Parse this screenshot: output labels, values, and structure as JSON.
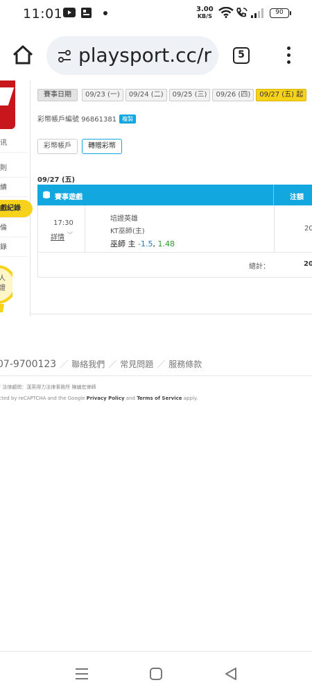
{
  "status_bar": {
    "time": "11:01",
    "speed_value": "3.00",
    "speed_unit": "KB/S",
    "battery": "90",
    "icons": [
      "youtube-icon",
      "gallery-icon",
      "notification-dot-icon",
      "wifi-icon",
      "wifi-calling-icon",
      "signal-icon",
      "battery-icon"
    ]
  },
  "browser": {
    "url": "playsport.cc/r",
    "tab_count": "5",
    "icons": [
      "home-icon",
      "site-settings-icon",
      "tabs-icon",
      "menu-icon"
    ]
  },
  "sidebar": {
    "items": [
      {
        "label": "讯",
        "active": false
      },
      {
        "label": "則",
        "active": false
      },
      {
        "label": "績",
        "active": false
      },
      {
        "label": "戲紀錄",
        "active": true
      },
      {
        "label": "倫",
        "active": false
      },
      {
        "label": "錄",
        "active": false
      }
    ],
    "bulb_text": [
      "人",
      "證"
    ]
  },
  "dates": {
    "label": "賽事日期",
    "chips": [
      {
        "label": "09/23 (一)",
        "active": false
      },
      {
        "label": "09/24 (二)",
        "active": false
      },
      {
        "label": "09/25 (三)",
        "active": false
      },
      {
        "label": "09/26 (四)",
        "active": false
      },
      {
        "label": "09/27 (五) 起",
        "active": true
      }
    ]
  },
  "account": {
    "label": "彩幣帳戶編號 96861381",
    "copy_label": "複製"
  },
  "tabs": [
    {
      "label": "彩幣帳戶",
      "active": false
    },
    {
      "label": "轉贈彩幣",
      "active": true
    }
  ],
  "section_date": "09/27 (五)",
  "table": {
    "headers": {
      "game": "賽事遊戲",
      "stake": "注額"
    },
    "rows": [
      {
        "time": "17:30",
        "detail": "詳情",
        "league": "培證英雄",
        "match": "KT巫師(主)",
        "pick_team": "巫師 主",
        "pick_handicap": "-1.5",
        "pick_sep": ",",
        "pick_odds": "1.48",
        "stake": "20"
      }
    ],
    "total_label": "總計：",
    "total_value": "20"
  },
  "footer": {
    "phone": "07-9700123",
    "links": [
      "聯絡我們",
      "常見問題",
      "服務條款"
    ],
    "legal_counsel": "所 法律顧問：漢英得力法律事務所 陳鎮宏律師",
    "recaptcha_prefix": "ected by reCAPTCHA and the Google",
    "privacy": "Privacy Policy",
    "and": "and",
    "terms": "Terms of Service",
    "apply": "apply."
  },
  "nav_bar": {
    "icons": [
      "recent-apps-icon",
      "home-nav-icon",
      "back-icon"
    ]
  }
}
